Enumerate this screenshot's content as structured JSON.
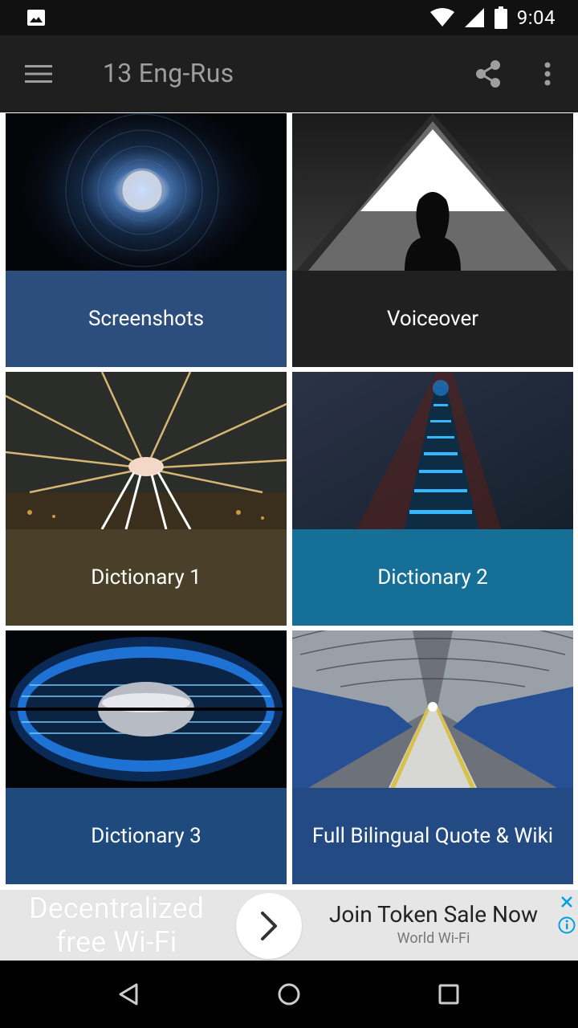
{
  "status_bar": {
    "time": "9:04",
    "icons": [
      "image-notification-icon",
      "wifi-icon",
      "signal-icon",
      "battery-icon"
    ]
  },
  "app_bar": {
    "title": "13 Eng-Rus",
    "icons": [
      "menu-icon",
      "share-icon",
      "more-vert-icon"
    ]
  },
  "tiles": [
    {
      "label": "Screenshots",
      "color": "#2c4e7e"
    },
    {
      "label": "Voiceover",
      "color": "#202020"
    },
    {
      "label": "Dictionary 1",
      "color": "#4a3f28"
    },
    {
      "label": "Dictionary 2",
      "color": "#156f96"
    },
    {
      "label": "Dictionary 3",
      "color": "#1e4a7e"
    },
    {
      "label": "Full Bilingual Quote & Wiki",
      "color": "#234a82"
    }
  ],
  "ad": {
    "big_text": "Decentralized free Wi-Fi",
    "headline": "Join Token Sale Now",
    "advertiser": "World Wi-Fi",
    "accent": "#00a0e0"
  },
  "nav_bar": {
    "icons": [
      "back-icon",
      "home-icon",
      "recents-icon"
    ]
  }
}
